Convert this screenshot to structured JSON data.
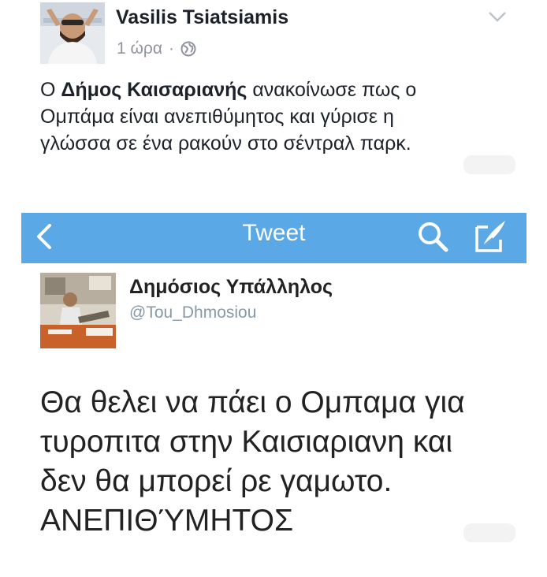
{
  "facebook_post": {
    "author_name": "Vasilis Tsiatsiamis",
    "time": "1 ώρα",
    "separator": "·",
    "privacy_icon": "globe-icon",
    "menu_icon": "chevron-down-icon",
    "text_line_1_prefix": "Ο ",
    "text_line_1_bold": "Δήμος Καισαριανής",
    "text_line_1_suffix": " ανακοίνωσε πως ο",
    "text_line_2": "Ομπάμα είναι ανεπιθύμητος και γύρισε η",
    "text_line_3": "γλώσσα σε ένα ρακούν στο σέντραλ παρκ."
  },
  "twitter_screenshot": {
    "nav": {
      "title": "Tweet",
      "back_icon": "chevron-left-icon",
      "search_icon": "search-icon",
      "compose_icon": "compose-icon",
      "bar_color": "#5aa9e6"
    },
    "author_name": "Δημόσιος Υπάλληλος",
    "handle": "@Tou_Dhmosiou",
    "tweet_lines": [
      "Θα θελει να πάει ο Ομπαμα για",
      "τυροπιτα στην Καισιαριανη και",
      "δεν θα μπορεί ρε γαμωτο.",
      "ΑΝΕΠΙΘΎΜΗΤΟΣ"
    ]
  }
}
